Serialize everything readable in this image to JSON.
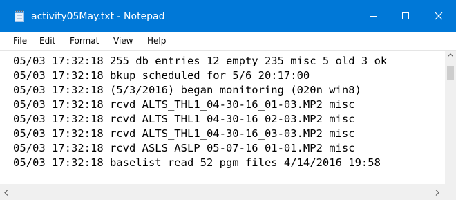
{
  "window": {
    "title": "activity05May.txt - Notepad",
    "accent_color": "#0078d7",
    "icon": "notepad-icon"
  },
  "caption_buttons": {
    "minimize_icon": "minimize-icon",
    "maximize_icon": "maximize-icon",
    "close_icon": "close-icon"
  },
  "menu": {
    "file": "File",
    "edit": "Edit",
    "format": "Format",
    "view": "View",
    "help": "Help"
  },
  "editor": {
    "lines": [
      "05/03 17:32:18 255 db entries 12 empty 235 misc 5 old 3 ok",
      "05/03 17:32:18 bkup scheduled for 5/6 20:17:00",
      "05/03 17:32:18 (5/3/2016) began monitoring (020n win8)",
      "05/03 17:32:18 rcvd ALTS_THL1_04-30-16_01-03.MP2 misc",
      "05/03 17:32:18 rcvd ALTS_THL1_04-30-16_02-03.MP2 misc",
      "05/03 17:32:18 rcvd ALTS_THL1_04-30-16_03-03.MP2 misc",
      "05/03 17:32:18 rcvd ASLS_ASLP_05-07-16_01-01.MP2 misc",
      "05/03 17:32:18 baselist read 52 pgm files 4/14/2016 19:58"
    ]
  },
  "scrollbars": {
    "up_arrow": "scroll-up-arrow-icon",
    "left_arrow": "scroll-left-arrow-icon",
    "right_arrow": "scroll-right-arrow-icon"
  }
}
